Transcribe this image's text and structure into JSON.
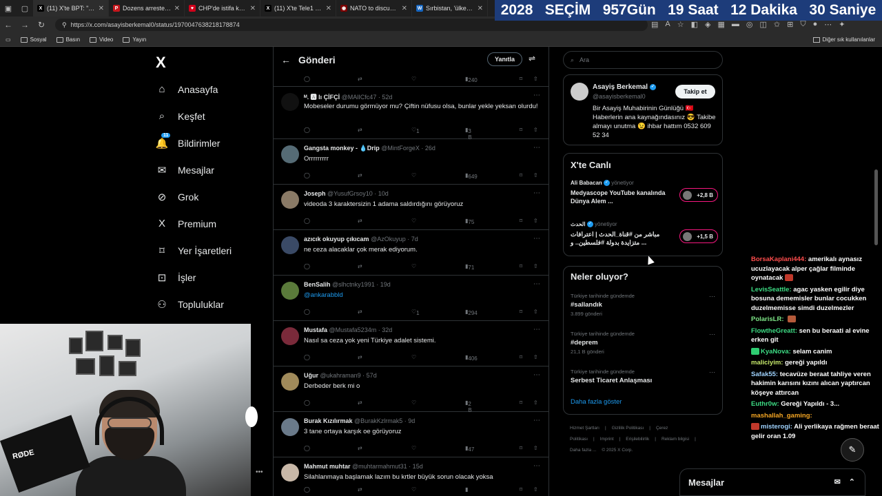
{
  "browser": {
    "tabs": [
      {
        "label": "(11) X'te BPT: \"Ca...",
        "fav_color": "#000000",
        "fav_glyph": "X"
      },
      {
        "label": "Dozens arrested a...",
        "fav_color": "#c4161c",
        "fav_glyph": "P"
      },
      {
        "label": "CHP'de istifa krizi:...",
        "fav_color": "#d0021b",
        "fav_glyph": "♥"
      },
      {
        "label": "(11) X'te Tele1 TV:...",
        "fav_color": "#000000",
        "fav_glyph": "X"
      },
      {
        "label": "NATO to discuss R...",
        "fav_color": "#7a0000",
        "fav_glyph": "◉"
      },
      {
        "label": "Sırbistan, 'ülkenin ...",
        "fav_color": "#1565c0",
        "fav_glyph": "W"
      }
    ],
    "url": "https://x.com/asayisberkemal0/status/1970047638218178874",
    "bookmarks": [
      "Sosyal",
      "Basın",
      "Video",
      "Yayın"
    ],
    "other_bookmarks": "Diğer sık kullanılanlar"
  },
  "countdown": [
    "2028",
    "SEÇİM",
    "957Gün",
    "19 Saat",
    "12 Dakika",
    "30 Saniye"
  ],
  "x": {
    "logo": "X",
    "nav": [
      {
        "label": "Anasayfa",
        "icon": "home-icon",
        "glyph": "⌂"
      },
      {
        "label": "Keşfet",
        "icon": "search-icon",
        "glyph": "⌕"
      },
      {
        "label": "Bildirimler",
        "icon": "bell-icon",
        "glyph": "🔔",
        "badge": "11"
      },
      {
        "label": "Mesajlar",
        "icon": "mail-icon",
        "glyph": "✉"
      },
      {
        "label": "Grok",
        "icon": "grok-icon",
        "glyph": "⊘"
      },
      {
        "label": "Premium",
        "icon": "x-premium-icon",
        "glyph": "X"
      },
      {
        "label": "Yer İşaretleri",
        "icon": "bookmark-icon",
        "glyph": "⌑"
      },
      {
        "label": "İşler",
        "icon": "briefcase-icon",
        "glyph": "⊡"
      },
      {
        "label": "Topluluklar",
        "icon": "people-icon",
        "glyph": "⚇"
      }
    ]
  },
  "main": {
    "title": "Gönderi",
    "reply_button": "Yanıtla",
    "top_views": "240",
    "tweets": [
      {
        "name": "ᴹ. 🅰 lı ÇİFÇİ",
        "handle": "@MAlICfc47 · 52d",
        "text": "Mobeseler durumu görmüyor mu? Çiftin nüfusu olsa, bunlar yekle yeksan olurdu!",
        "likes": "1",
        "views": "3 B",
        "avatar": "#111111"
      },
      {
        "name": "Gangsta monkey - 💧Drip",
        "handle": "@MintForgeX · 26d",
        "text": "Orrrrrrrrr",
        "likes": "",
        "views": "649",
        "avatar": "#556b75"
      },
      {
        "name": "Joseph",
        "handle": "@YusufGrsoy10 · 10d",
        "text": "videoda 3 karaktersizin 1 adama saldırdığını görüyoruz",
        "likes": "",
        "views": "75",
        "avatar": "#8a7a66"
      },
      {
        "name": "azıcık okuyup çıkıcam",
        "handle": "@AzOkuyup · 7d",
        "text": "ne ceza alacaklar çok merak ediyorum.",
        "likes": "",
        "views": "71",
        "avatar": "#3a4a66"
      },
      {
        "name": "BenSalih",
        "handle": "@slhctnky1991 · 19d",
        "text": "@ankarabbld",
        "likes": "1",
        "views": "294",
        "avatar": "#5a7a3a",
        "link": true
      },
      {
        "name": "Mustafa",
        "handle": "@Mustafa5234m · 32d",
        "text": "Nasıl sa ceza yok yeni Türkiye adalet sistemi.",
        "likes": "",
        "views": "406",
        "avatar": "#7a2a3a"
      },
      {
        "name": "Uğur",
        "handle": "@ukahraman9 · 57d",
        "text": "Derbeder berk mi o",
        "likes": "",
        "views": "2 B",
        "avatar": "#a08a5a"
      },
      {
        "name": "Burak Kızılırmak",
        "handle": "@BurakKzlrmak5 · 9d",
        "text": "3 tane ortaya karşık  oe görüyoruz",
        "likes": "",
        "views": "47",
        "avatar": "#6a7a8a"
      },
      {
        "name": "Mahmut muhtar",
        "handle": "@muhtarmahmut31 · 15d",
        "text": "Silahlanmaya başlamak lazım bu krtler büyük sorun olacak yoksa",
        "likes": "",
        "views": "",
        "avatar": "#c8b8a8"
      }
    ]
  },
  "right": {
    "search_placeholder": "Ara",
    "profile": {
      "name": "Asayiş Berkemal",
      "handle": "@asayisberkemal0",
      "follow": "Takip et",
      "bio": "Bir Asayiş Muhabirinin Günlüğü 🇹🇷 Haberlerin ana kaynağındasınız 😎 Takibe almayı unutma 😉 ihbar hattım 0532 609 52 34"
    },
    "live": {
      "title": "X'te Canlı",
      "items": [
        {
          "host": "Ali Babacan",
          "role": "yönetiyor",
          "text": "Medyascope YouTube kanalında Dünya Alem ...",
          "count": "+2,8 B"
        },
        {
          "host": "الحدث",
          "role": "yönetiyor",
          "text": "مباشر من #قناة_الحدث | اعترافات متزايدة بدولة #فلسطين.. و ...",
          "count": "+1,5 B"
        }
      ]
    },
    "trends": {
      "title": "Neler oluyor?",
      "items": [
        {
          "context": "Türkiye tarihinde gündemde",
          "name": "#sallandık",
          "count": "3.899 gönderi"
        },
        {
          "context": "Türkiye tarihinde gündemde",
          "name": "#deprem",
          "count": "21,1 B gönderi"
        },
        {
          "context": "Türkiye tarihinde gündemde",
          "name": "Serbest Ticaret Anlaşması",
          "count": ""
        }
      ],
      "show_more": "Daha fazla göster"
    },
    "footer": [
      "Hizmet Şartları",
      "|",
      "Gizlilik Politikası",
      "|",
      "Çerez Politikası",
      "|",
      "Imprint",
      "|",
      "Erişilebilirlik",
      "|",
      "Reklam bilgisi",
      "|",
      "Daha fazla ...",
      "© 2025 X Corp."
    ]
  },
  "chat": [
    {
      "user": "BorsaKaplani444:",
      "color": "#ff4d4d",
      "text": "amerikalı aynasız ucuzlayacak alper çağlar filminde oynatacak",
      "emote": "#c0392b"
    },
    {
      "user": "LevisSeattle:",
      "color": "#3ddc84",
      "text": "agac yasken egilir diye bosuna dememisler bunlar cocukken duzelmemisse simdi duzelmezler"
    },
    {
      "user": "PolarisLR:",
      "color": "#7ee787",
      "text": "",
      "emote": "#b55a3a"
    },
    {
      "user": "FlowtheGreatt:",
      "color": "#3ddc84",
      "text": "sen bu beraati al evine erken git"
    },
    {
      "user": "KyaNova:",
      "color": "#3ddc84",
      "text": "selam canim",
      "emote_before": "#2ecc71"
    },
    {
      "user": "maliciyim:",
      "color": "#c7e96b",
      "text": "gereği yapıldı"
    },
    {
      "user": "Safak55:",
      "color": "#9fd3ff",
      "text": "tecavüze beraat tahliye veren hakimin karısını kızını alıcan yaptırcan köşeye attırcan"
    },
    {
      "user": "Euthr0w:",
      "color": "#3ddc84",
      "text": "Gereği Yapıldı - 3..."
    },
    {
      "user": "mashallah_gaming:",
      "color": "#f5a623",
      "text": ""
    },
    {
      "user": "misterogi:",
      "color": "#9fd3ff",
      "text": "Ali yerlikaya rağmen beraat gelir oran 1.09",
      "emote_before": "#c0392b"
    }
  ],
  "messages_drawer": "Mesajlar",
  "webcam": {
    "brand": "RØDE"
  }
}
